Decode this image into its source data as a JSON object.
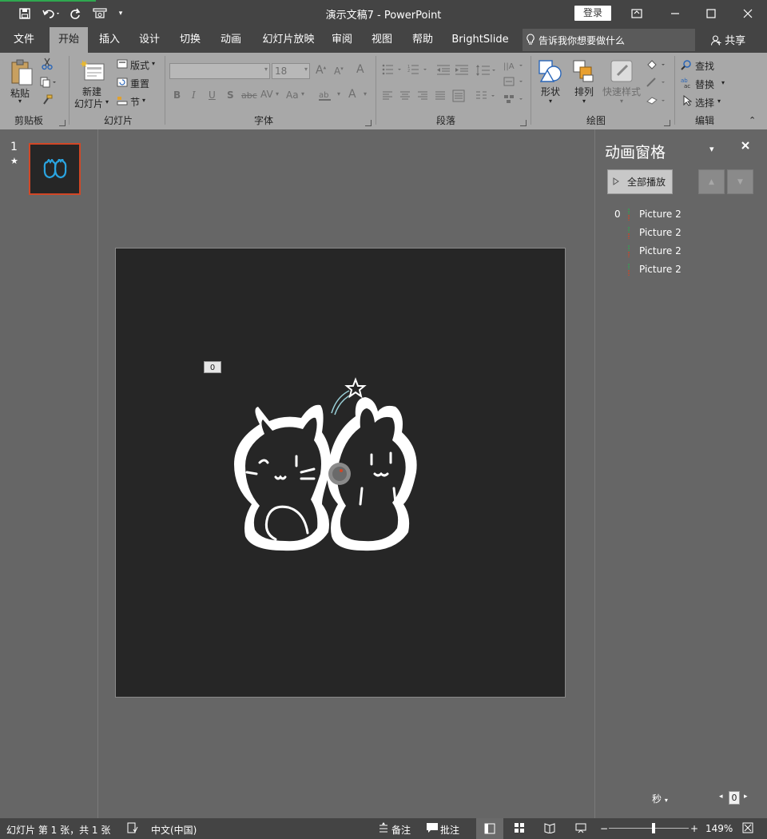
{
  "titlebar": {
    "doc_title": "演示文稿7  -  PowerPoint",
    "login_label": "登录"
  },
  "tabs": [
    {
      "label": "文件"
    },
    {
      "label": "开始"
    },
    {
      "label": "插入"
    },
    {
      "label": "设计"
    },
    {
      "label": "切换"
    },
    {
      "label": "动画"
    },
    {
      "label": "幻灯片放映"
    },
    {
      "label": "审阅"
    },
    {
      "label": "视图"
    },
    {
      "label": "帮助"
    },
    {
      "label": "BrightSlide"
    }
  ],
  "tellme_placeholder": "告诉我你想要做什么",
  "share_label": "共享",
  "ribbon": {
    "clipboard": {
      "paste_label": "粘贴",
      "group_label": "剪贴板"
    },
    "slides": {
      "new_slide_line1": "新建",
      "new_slide_line2": "幻灯片",
      "layout_label": "版式",
      "reset_label": "重置",
      "section_label": "节",
      "group_label": "幻灯片"
    },
    "font": {
      "font_size": "18",
      "group_label": "字体",
      "bold": "B",
      "italic": "I",
      "underline": "U",
      "shadow": "S",
      "strike": "abc",
      "spacing": "AV",
      "case": "Aa",
      "color": "A"
    },
    "paragraph": {
      "group_label": "段落"
    },
    "drawing": {
      "shapes_label": "形状",
      "arrange_label": "排列",
      "quick_styles_label": "快速样式",
      "group_label": "绘图"
    },
    "editing": {
      "find_label": "查找",
      "replace_label": "替换",
      "select_label": "选择",
      "group_label": "编辑"
    }
  },
  "thumbnails": {
    "slide_number": "1",
    "star": "★"
  },
  "slide": {
    "anim_tag": "0",
    "background": "#262626"
  },
  "animation_pane": {
    "title": "动画窗格",
    "play_all_label": "全部播放",
    "items": [
      {
        "num": "0",
        "label": "Picture 2"
      },
      {
        "num": "",
        "label": "Picture 2"
      },
      {
        "num": "",
        "label": "Picture 2"
      },
      {
        "num": "",
        "label": "Picture 2"
      }
    ],
    "seconds_label": "秒",
    "timeline_value": "0"
  },
  "statusbar": {
    "slide_info": "幻灯片 第 1 张，共 1 张",
    "language": "中文(中国)",
    "notes_label": "备注",
    "comments_label": "批注",
    "zoom": "149%"
  },
  "colors": {
    "titlebar": "#444444",
    "ribbon": "#a8a8a8",
    "workspace": "#666666",
    "accent_red": "#d24726",
    "accent_blue": "#2aa4e0"
  }
}
